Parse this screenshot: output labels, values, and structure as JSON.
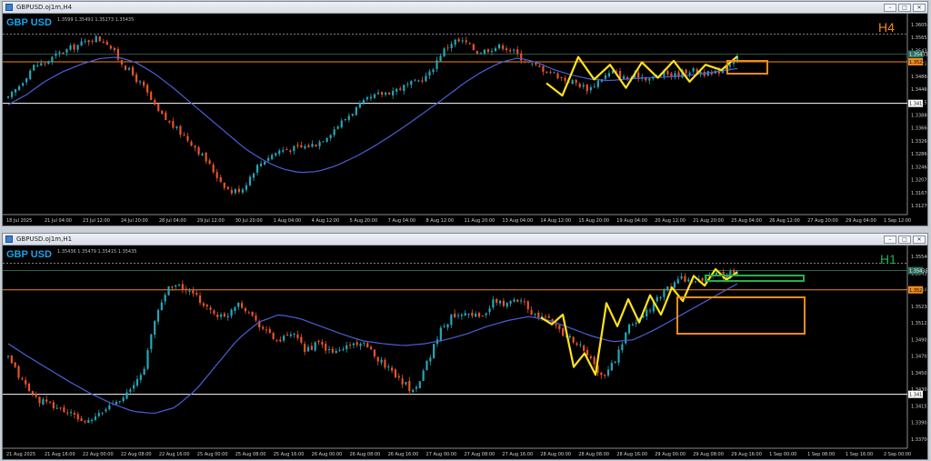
{
  "colors": {
    "bull": "#26a6b9",
    "bear": "#e8542a",
    "ma": "#4a5fd6",
    "zigzag": "#ffe319",
    "box": "#f08a1c",
    "greenbox": "#22b14c",
    "hline": "#ffffff",
    "resist": "#f08a1c"
  },
  "h4": {
    "title": "GBPUSD.oj1m,H4",
    "ohlc": "1.3599 1.35491 1.35273 1.35435",
    "symbol": "GBP USD",
    "timeframe": "H4",
    "price_labels": [
      "1.36050",
      "1.35657",
      "1.35433",
      "1.35236",
      "1.34860",
      "1.34460",
      "1.34157",
      "1.33880",
      "1.33660",
      "1.33260",
      "1.32860",
      "1.32460",
      "1.32070",
      "1.31670",
      "1.31270"
    ],
    "time_labels": [
      "18 Jul 2025",
      "21 Jul 04:00",
      "23 Jul 12:00",
      "24 Jul 20:00",
      "28 Jul 04:00",
      "29 Jul 12:00",
      "30 Jul 20:00",
      "1 Aug 04:00",
      "4 Aug 12:00",
      "5 Aug 20:00",
      "7 Aug 04:00",
      "8 Aug 12:00",
      "11 Aug 20:00",
      "13 Aug 04:00",
      "14 Aug 12:00",
      "15 Aug 20:00",
      "19 Aug 04:00",
      "20 Aug 12:00",
      "21 Aug 20:00",
      "25 Aug 04:00",
      "26 Aug 12:00",
      "27 Aug 20:00",
      "29 Aug 04:00",
      "1 Sep 12:00"
    ]
  },
  "h1": {
    "title": "GBPUSD.oj1m,H1",
    "ohlc": "1.35436 1.35479 1.35415 1.35435",
    "symbol": "GBP USD",
    "timeframe": "H1",
    "price_labels": [
      "1.35540",
      "1.35435",
      "1.35340",
      "1.35236",
      "1.35125",
      "1.34905",
      "1.34705",
      "1.34505",
      "1.34300",
      "1.34157",
      "1.33905",
      "1.33700"
    ],
    "time_labels": [
      "21 Aug 2025",
      "21 Aug 16:00",
      "22 Aug 00:00",
      "22 Aug 08:00",
      "22 Aug 16:00",
      "25 Aug 00:00",
      "25 Aug 08:00",
      "25 Aug 16:00",
      "26 Aug 00:00",
      "26 Aug 08:00",
      "26 Aug 16:00",
      "27 Aug 00:00",
      "27 Aug 08:00",
      "27 Aug 16:00",
      "28 Aug 00:00",
      "28 Aug 08:00",
      "28 Aug 16:00",
      "29 Aug 00:00",
      "29 Aug 08:00",
      "29 Aug 16:00",
      "1 Sep 00:00",
      "1 Sep 08:00",
      "1 Sep 16:00",
      "2 Sep 00:00"
    ]
  },
  "chart_data": [
    {
      "type": "candlestick",
      "title": "GBPUSD.oj1m,H4",
      "ylim": [
        1.3127,
        1.3625
      ],
      "levels": {
        "dotted_top": 1.35957,
        "resistance": 1.35236,
        "support": 1.34157,
        "current": 1.35435
      },
      "close_path": [
        1.3428,
        1.3466,
        1.3512,
        1.3521,
        1.3543,
        1.3558,
        1.3572,
        1.3587,
        1.3574,
        1.3528,
        1.3492,
        1.3455,
        1.3398,
        1.3366,
        1.3338,
        1.3308,
        1.3268,
        1.3222,
        1.3185,
        1.3196,
        1.3248,
        1.3276,
        1.3294,
        1.3298,
        1.3303,
        1.3312,
        1.3338,
        1.3368,
        1.3398,
        1.3423,
        1.3439,
        1.3447,
        1.3459,
        1.3471,
        1.3488,
        1.3545,
        1.3578,
        1.3574,
        1.3548,
        1.3558,
        1.3565,
        1.3548,
        1.3521,
        1.3508,
        1.3496,
        1.3478,
        1.3468,
        1.3452,
        1.3482,
        1.3498,
        1.3478,
        1.3488,
        1.3479,
        1.3495,
        1.3488,
        1.3502,
        1.3498,
        1.3488,
        1.3512,
        1.3538
      ],
      "ma_path": [
        1.3412,
        1.3438,
        1.3472,
        1.3498,
        1.3517,
        1.3532,
        1.3536,
        1.3522,
        1.3494,
        1.3458,
        1.3418,
        1.3378,
        1.3338,
        1.3298,
        1.3268,
        1.3246,
        1.3236,
        1.3239,
        1.3254,
        1.3276,
        1.3302,
        1.3332,
        1.3364,
        1.3398,
        1.3432,
        1.3468,
        1.3498,
        1.3522,
        1.3534,
        1.3522,
        1.3502,
        1.3488,
        1.3478,
        1.3475,
        1.3479,
        1.3482,
        1.3484,
        1.3487,
        1.3492,
        1.3499,
        1.3506
      ],
      "zigzag": [
        1.3468,
        1.3436,
        1.3536,
        1.3478,
        1.3516,
        1.3456,
        1.3522,
        1.3482,
        1.3526,
        1.3472,
        1.3516,
        1.3502,
        1.3538
      ]
    },
    {
      "type": "candlestick",
      "title": "GBPUSD.oj1m,H1",
      "ylim": [
        1.336,
        1.356
      ],
      "levels": {
        "dotted_top": 1.3551,
        "resistance": 1.35236,
        "support": 1.34157,
        "current": 1.35435
      },
      "close_path": [
        1.3453,
        1.343,
        1.3412,
        1.3405,
        1.34,
        1.3392,
        1.3386,
        1.3398,
        1.341,
        1.3418,
        1.344,
        1.35,
        1.353,
        1.3525,
        1.3515,
        1.3502,
        1.3494,
        1.3512,
        1.3498,
        1.3482,
        1.347,
        1.3478,
        1.3462,
        1.3468,
        1.3458,
        1.3465,
        1.347,
        1.3458,
        1.3445,
        1.3432,
        1.3418,
        1.3448,
        1.3482,
        1.3498,
        1.3502,
        1.3494,
        1.3512,
        1.3508,
        1.3516,
        1.3496,
        1.3494,
        1.348,
        1.347,
        1.3455,
        1.3432,
        1.3452,
        1.3485,
        1.3498,
        1.3512,
        1.3528,
        1.3536,
        1.353,
        1.354,
        1.3538,
        1.3544
      ],
      "ma_path": [
        1.3468,
        1.3454,
        1.3441,
        1.3428,
        1.3416,
        1.3406,
        1.3398,
        1.3396,
        1.3402,
        1.342,
        1.3446,
        1.3472,
        1.349,
        1.3498,
        1.3494,
        1.3486,
        1.3478,
        1.3471,
        1.3468,
        1.3466,
        1.3468,
        1.3472,
        1.3478,
        1.3486,
        1.3492,
        1.3496,
        1.3492,
        1.3484,
        1.3476,
        1.347,
        1.3472,
        1.3482,
        1.3494,
        1.3506,
        1.3518,
        1.353
      ],
      "zigzag": [
        1.3495,
        1.3488,
        1.3498,
        1.3444,
        1.3458,
        1.3436,
        1.351,
        1.3486,
        1.3514,
        1.349,
        1.3518,
        1.3498,
        1.3526,
        1.3512,
        1.3538,
        1.3528,
        1.3545,
        1.3534,
        1.3542
      ]
    }
  ]
}
